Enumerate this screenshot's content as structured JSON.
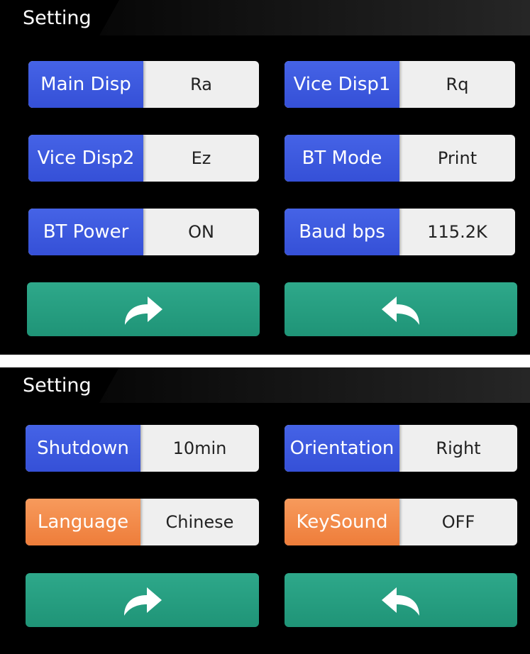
{
  "screen1": {
    "header": {
      "title": "Setting"
    },
    "settings": [
      {
        "label": "Main Disp",
        "value": "Ra"
      },
      {
        "label": "Vice Disp1",
        "value": "Rq"
      },
      {
        "label": "Vice Disp2",
        "value": "Ez"
      },
      {
        "label": "BT Mode",
        "value": "Print"
      },
      {
        "label": "BT Power",
        "value": "ON"
      },
      {
        "label": "Baud bps",
        "value": "115.2K"
      }
    ],
    "buttons": [
      {
        "icon": "forward-arrow-icon"
      },
      {
        "icon": "back-arrow-icon"
      }
    ]
  },
  "screen2": {
    "header": {
      "title": "Setting"
    },
    "settings": [
      {
        "label": "Shutdown",
        "value": "10min"
      },
      {
        "label": "Orientation",
        "value": "Right"
      },
      {
        "label": "Language",
        "value": "Chinese"
      },
      {
        "label": "KeySound",
        "value": "OFF"
      }
    ],
    "buttons": [
      {
        "icon": "forward-arrow-icon"
      },
      {
        "icon": "back-arrow-icon"
      }
    ]
  },
  "colors": {
    "label_blue": "#3f5ce0",
    "label_orange": "#f18a4a",
    "button_green": "#26a07f",
    "value_bg": "#efefef"
  }
}
